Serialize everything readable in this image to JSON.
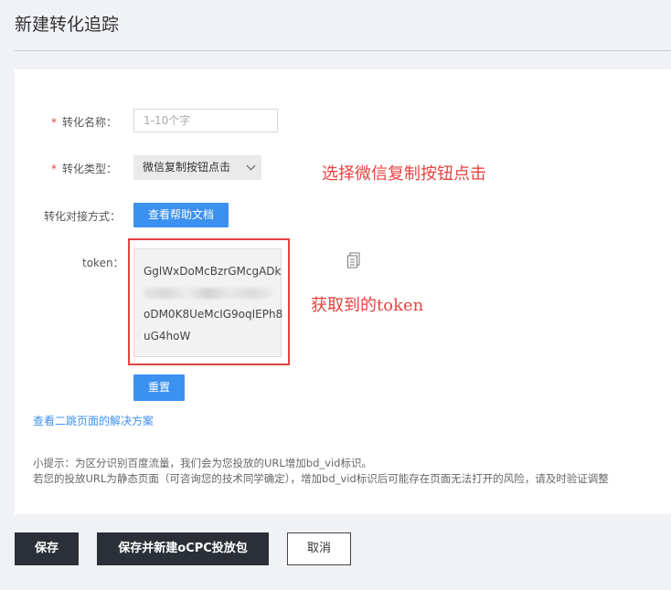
{
  "page": {
    "title": "新建转化追踪"
  },
  "form": {
    "name": {
      "label": "转化名称：",
      "placeholder": "1-10个字",
      "required": true
    },
    "type": {
      "label": "转化类型：",
      "value": "微信复制按钮点击",
      "required": true
    },
    "integration": {
      "label": "转化对接方式：",
      "button_label": "查看帮助文档"
    },
    "token": {
      "label": "token：",
      "line1": "GglWxDoMcBzrGMcgADk",
      "line3": "oDM0K8UeMcIG9oqIEPh8",
      "line4": "uG4hoW",
      "reset_label": "重置"
    },
    "link_label": "查看二跳页面的解决方案",
    "tips": {
      "line1": "小提示：为区分识别百度流量，我们会为您投放的URL增加bd_vid标识。",
      "line2": "若您的投放URL为静态页面（可咨询您的技术同学确定），增加bd_vid标识后可能存在页面无法打开的风险，请及时验证调整"
    }
  },
  "annotations": {
    "type_note": "选择微信复制按钮点击",
    "token_note": "获取到的token"
  },
  "footer": {
    "save_label": "保存",
    "save_new_label": "保存并新建oCPC投放包",
    "cancel_label": "取消"
  },
  "colors": {
    "primary": "#3c91f0",
    "annotation": "#e64340",
    "dark_button": "#2b3038"
  }
}
